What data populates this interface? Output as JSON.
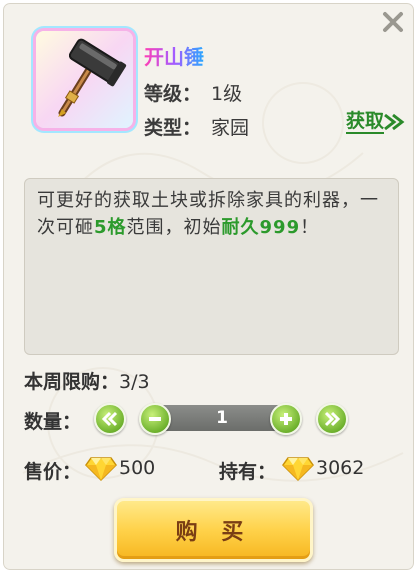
{
  "item": {
    "name": "开山锤",
    "level_label": "等级：",
    "level_value": "1级",
    "type_label": "类型：",
    "type_value": "家园",
    "acquire_label": "获取",
    "icon": "hammer-icon"
  },
  "description": {
    "part1": "可更好的获取土块或拆除家具的利器，一次可砸",
    "hl1": "5格",
    "part2": "范围，初始",
    "hl2": "耐久999",
    "part3": "！"
  },
  "purchase": {
    "weekly_limit_label": "本周限购：",
    "weekly_limit_value": "3/3",
    "quantity_label": "数量：",
    "quantity_value": "1",
    "price_label": "售价：",
    "price_value": "500",
    "owned_label": "持有：",
    "owned_value": "3062",
    "currency_icon": "diamond-icon",
    "buy_label": "购 买"
  },
  "colors": {
    "highlight": "#2c9a2c",
    "acquire": "#2a8a2a",
    "buy_button": "#ffd24a",
    "stepper": "#6fb22e"
  }
}
